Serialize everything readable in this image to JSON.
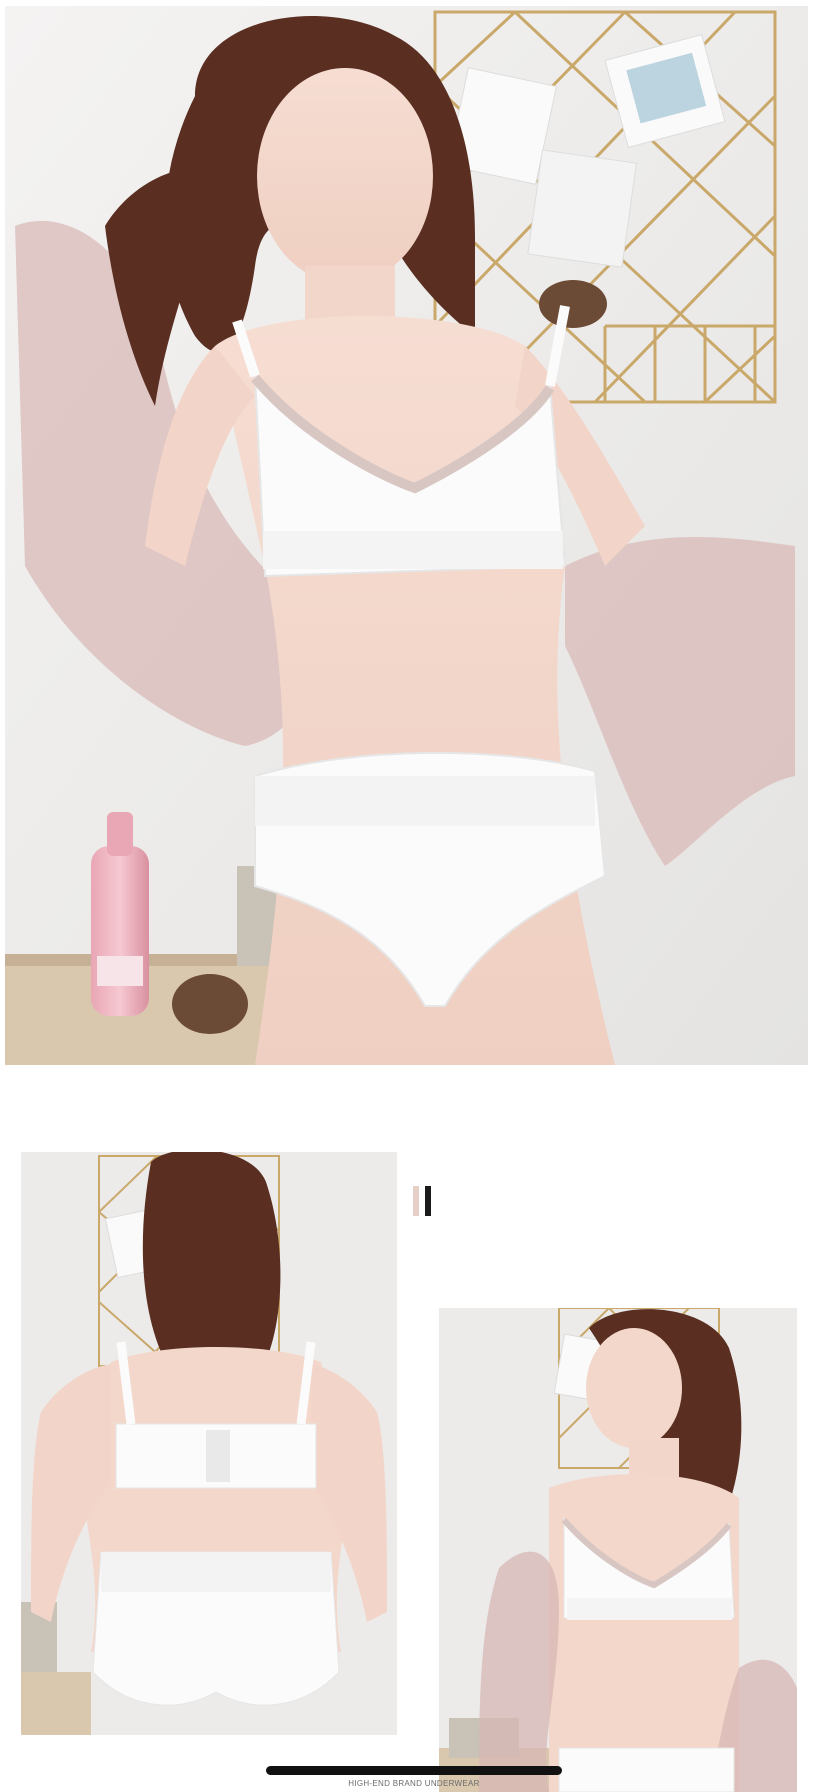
{
  "colors": {
    "page_background": "#ffffff",
    "wall": "#ecebea",
    "garment": "#fbfbfb",
    "sheer_jacket": "#d7b7b4",
    "hair": "#5a2f22",
    "skin": "#f3d7cb",
    "gold_grid": "#c9a86a",
    "accent_light": "#e6cfc6",
    "accent_dark": "#1a1a1a",
    "home_indicator": "#111111"
  },
  "photos": {
    "hero": {
      "subject": "model-front-view"
    },
    "back_view": {
      "subject": "model-back-view"
    },
    "side_view": {
      "subject": "model-side-view"
    }
  },
  "icons": {
    "accent": "double-bar-accent-icon",
    "home": "home-indicator-bar"
  },
  "footer": {
    "caption": "HIGH-END BRAND UNDERWEAR"
  }
}
